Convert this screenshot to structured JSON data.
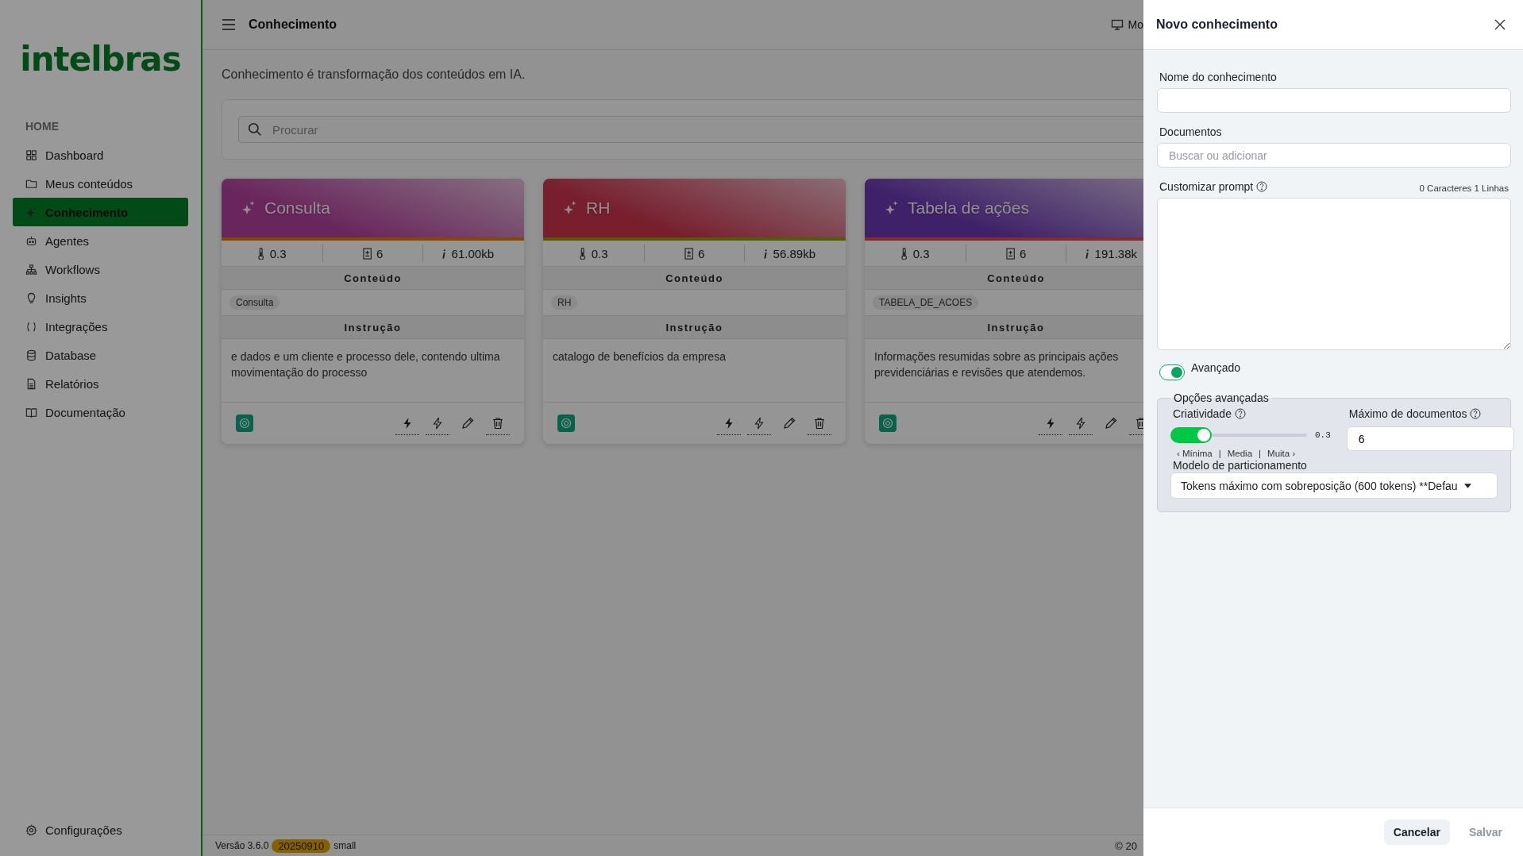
{
  "sidebar": {
    "logo": "intelbras",
    "section": "HOME",
    "items": [
      {
        "label": "Dashboard",
        "selected": false
      },
      {
        "label": "Meus conteúdos",
        "selected": false
      },
      {
        "label": "Conhecimento",
        "selected": true
      },
      {
        "label": "Agentes",
        "selected": false
      },
      {
        "label": "Workflows",
        "selected": false
      },
      {
        "label": "Insights",
        "selected": false
      },
      {
        "label": "Integrações",
        "selected": false
      },
      {
        "label": "Database",
        "selected": false
      },
      {
        "label": "Relatórios",
        "selected": false
      },
      {
        "label": "Documentação",
        "selected": false
      }
    ],
    "settings": "Configurações"
  },
  "header": {
    "title": "Conhecimento",
    "right_text": "Mo"
  },
  "page": {
    "subtitle": "Conhecimento é transformação dos conteúdos em IA.",
    "search": {
      "placeholder": "Procurar"
    }
  },
  "cards": [
    {
      "title": "Consulta",
      "temperature": "0.3",
      "documents": "6",
      "size": "61.00kb",
      "content_label": "Conteúdo",
      "tag": "Consulta",
      "instruction_label": "Instrução",
      "instruction": "e dados e um cliente e processo dele, contendo ultima movimentação do processo"
    },
    {
      "title": "RH",
      "temperature": "0.3",
      "documents": "6",
      "size": "56.89kb",
      "content_label": "Conteúdo",
      "tag": "RH",
      "instruction_label": "Instrução",
      "instruction": "catalogo de benefícios da empresa"
    },
    {
      "title": "Tabela de ações",
      "temperature": "0.3",
      "documents": "6",
      "size": "191.38k",
      "content_label": "Conteúdo",
      "tag": "TABELA_DE_ACOES",
      "instruction_label": "Instrução",
      "instruction": "Informações resumidas sobre as principais ações previdenciárias e revisões que atendemos."
    }
  ],
  "footer": {
    "version": "Versão 3.6.0",
    "build": "20250910",
    "size": "small",
    "copyright": "© 20"
  },
  "drawer": {
    "title": "Novo conhecimento",
    "name_field": {
      "label": "Nome do conhecimento"
    },
    "documents_field": {
      "label": "Documentos",
      "placeholder": "Buscar ou adicionar"
    },
    "prompt_field": {
      "label": "Customizar prompt",
      "counter": "0 Caracteres 1 Linhas"
    },
    "advanced_toggle": {
      "label": "Avançado",
      "on": true
    },
    "advanced": {
      "legend": "Opções avançadas",
      "creativity": {
        "label": "Criatividade",
        "level": 0.3,
        "reading": "0.3",
        "scale": [
          "‹ Mínima",
          "|",
          "Media",
          "|",
          "Muita ›"
        ]
      },
      "max_documents": {
        "label": "Máximo de documentos",
        "value": "6"
      },
      "partition": {
        "label": "Modelo de particionamento",
        "value": "Tokens máximo com sobreposição (600 tokens) **Defau"
      }
    },
    "buttons": [
      {
        "label": "Cancelar",
        "disabled": false
      },
      {
        "label": "Salvar",
        "disabled": true
      }
    ]
  }
}
